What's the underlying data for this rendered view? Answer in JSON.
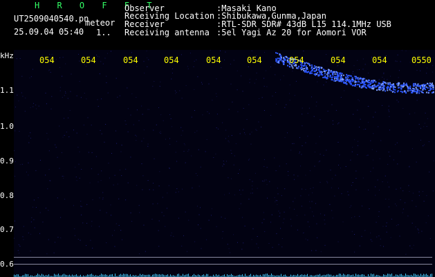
{
  "app": {
    "title": "H R O F F T"
  },
  "file": {
    "name": "UT2509040540.pn",
    "label": "meteor",
    "datetime": "25.09.04 05:40",
    "extra": "1.."
  },
  "info": {
    "observer": {
      "label": "Observer",
      "value": ":Masaki Kano"
    },
    "location": {
      "label": "Receiving Location",
      "value": ":Shibukawa,Gunma,Japan"
    },
    "receiver": {
      "label": "Receiver",
      "value": ":RTL-SDR SDR# 43dB L15 114.1MHz USB"
    },
    "antenna": {
      "label": "Receiving antenna",
      "value": ":5el Yagi Az 20 for Aomori VOR"
    }
  },
  "axis": {
    "unit": "kHz",
    "y_ticks": [
      "1.1",
      "1.0",
      "0.9",
      "0.8",
      "0.7",
      "0.6"
    ],
    "x_ticks": [
      "054",
      "054",
      "054",
      "054",
      "054",
      "054",
      "054",
      "054",
      "054",
      "0550"
    ]
  },
  "colors": {
    "title": "#33ff66",
    "text": "#ffffff",
    "accent": "#ffff00",
    "signal": "#2a55ff"
  }
}
